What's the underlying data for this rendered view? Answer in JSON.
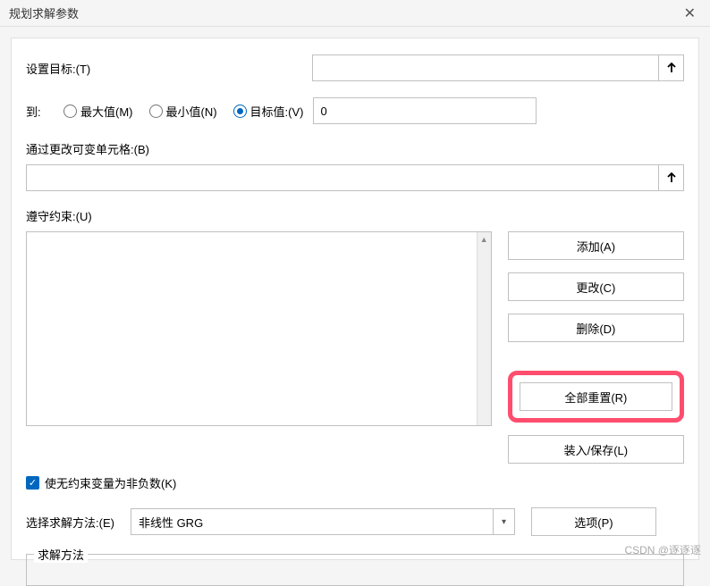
{
  "window": {
    "title": "规划求解参数"
  },
  "target": {
    "label": "设置目标:(T)",
    "value": ""
  },
  "to": {
    "label": "到:",
    "max": "最大值(M)",
    "min": "最小值(N)",
    "target": "目标值:(V)",
    "targetValue": "0"
  },
  "variable": {
    "label": "通过更改可变单元格:(B)",
    "value": ""
  },
  "constraints": {
    "label": "遵守约束:(U)",
    "buttons": {
      "add": "添加(A)",
      "change": "更改(C)",
      "delete": "删除(D)",
      "reset": "全部重置(R)",
      "loadsave": "装入/保存(L)"
    }
  },
  "nonneg": {
    "label": "使无约束变量为非负数(K)"
  },
  "method": {
    "label": "选择求解方法:(E)",
    "selected": "非线性 GRG",
    "options": "选项(P)"
  },
  "group": {
    "title": "求解方法"
  },
  "watermark": "CSDN @逐逐逐"
}
